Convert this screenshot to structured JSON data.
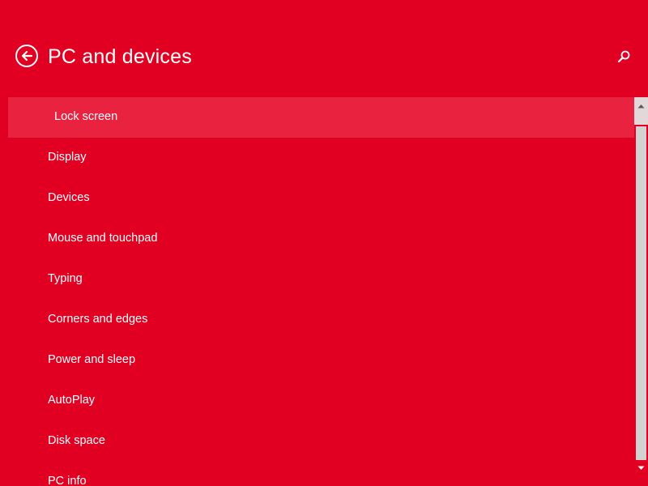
{
  "header": {
    "title": "PC and devices",
    "back_icon": "back-arrow-icon",
    "search_icon": "search-icon"
  },
  "nav": {
    "items": [
      {
        "label": "Lock screen",
        "selected": true
      },
      {
        "label": "Display",
        "selected": false
      },
      {
        "label": "Devices",
        "selected": false
      },
      {
        "label": "Mouse and touchpad",
        "selected": false
      },
      {
        "label": "Typing",
        "selected": false
      },
      {
        "label": "Corners and edges",
        "selected": false
      },
      {
        "label": "Power and sleep",
        "selected": false
      },
      {
        "label": "AutoPlay",
        "selected": false
      },
      {
        "label": "Disk space",
        "selected": false
      },
      {
        "label": "PC info",
        "selected": false
      }
    ]
  },
  "colors": {
    "background": "#e20022",
    "selected_item": "#e8223f",
    "scroll_thumb": "#d2d2d2",
    "text": "#ffffff"
  }
}
